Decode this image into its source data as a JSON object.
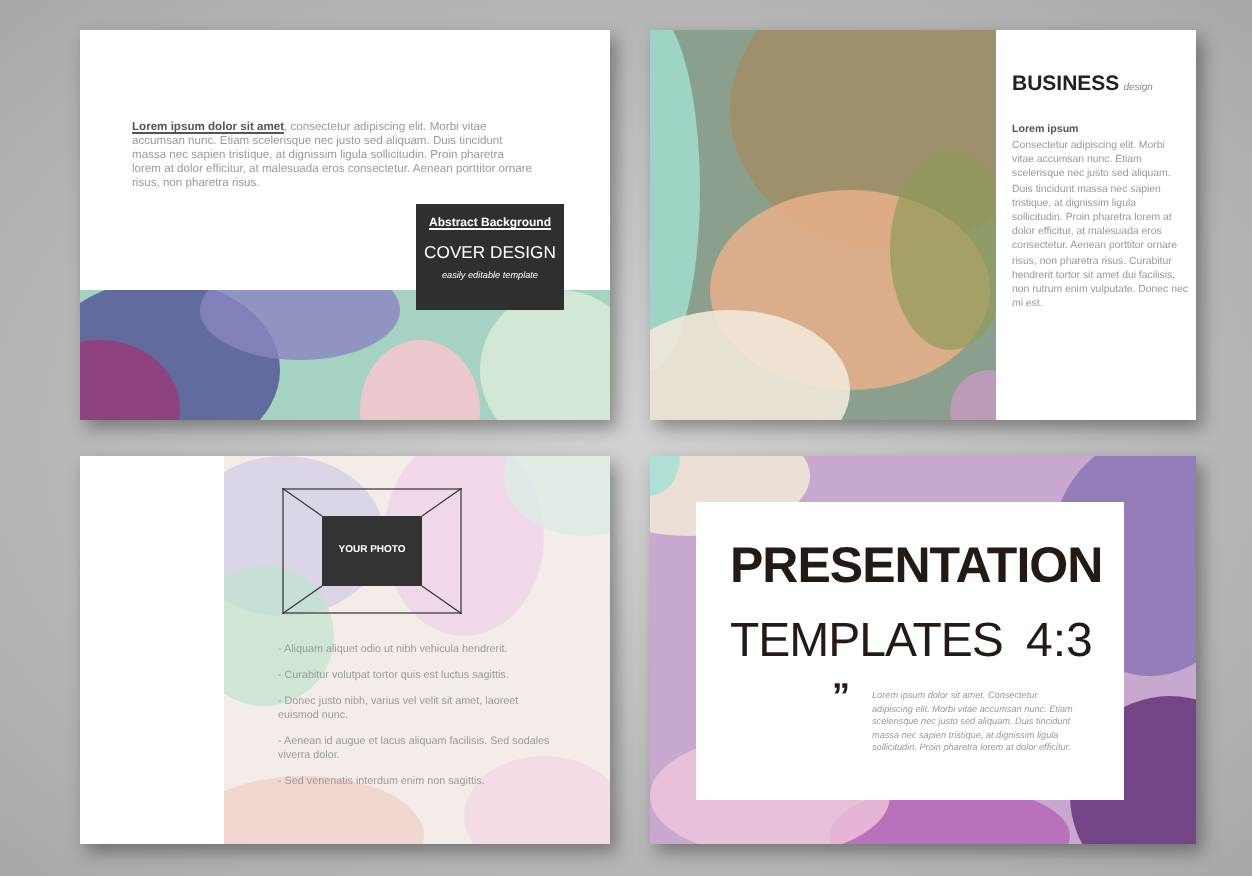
{
  "slides": [
    {
      "kind": "cover",
      "paragraph": "**Lorem ipsum dolor sit amet**, consectetur adipiscing elit. Morbi vitae accumsan nunc. Etiam scelerisque nec justo sed aliquam. Duis tincidunt massa nec sapien tristique, at dignissim ligula sollicitudin. Proin pharetra lorem at dolor efficitur, at malesuada eros consectetur. Aenean porttitor ornare risus, non pharetra risus.",
      "badge": {
        "kicker": "Abstract Background",
        "title": "COVER DESIGN",
        "subtitle": "easily editable template"
      }
    },
    {
      "kind": "business",
      "heading": "BUSINESS",
      "heading_suffix": "design",
      "subheading": "Lorem ipsum",
      "body": "Consectetur adipiscing elit. Morbi vitae accumsan nunc. Etiam scelerisque nec justo sed aliquam. Duis tincidunt massa nec sapien tristique, at dignissim ligula sollicitudin. Proin pharetra lorem at dolor efficitur, at malesuada eros consectetur. Aenean porttitor ornare risus, non pharetra risus. Curabitur hendrerit tortor sit amet dui facilisis, non rutrum enim vulputate. Donec nec mi est."
    },
    {
      "kind": "photo",
      "photo_label": "YOUR PHOTO",
      "bullets": [
        "- Aliquam aliquet odio ut nibh vehicula hendrerit.",
        "- Curabitur volutpat tortor quis est luctus sagittis.",
        "- Donec justo nibh, varius vel velit sit amet, laoreet euismod nunc.",
        "- Aenean id augue et lacus aliquam facilisis. Sed sodales viverra dolor.",
        "- Sed venenatis interdum enim non sagittis."
      ]
    },
    {
      "kind": "title",
      "title_line_1": "PRESENTATION",
      "title_line_2": "TEMPLATES",
      "ratio": "4:3",
      "quote_mark": "”",
      "quote": "Lorem ipsum dolor sit amet. Consectetur adipiscing elit. Morbi vitae accumsan nunc. Etiam scelerisque nec justo sed aliquam. Duis tincidunt massa nec sapien tristique, at dignissim ligula sollicitudin. Proin pharetra lorem at dolor efficitur."
    }
  ]
}
